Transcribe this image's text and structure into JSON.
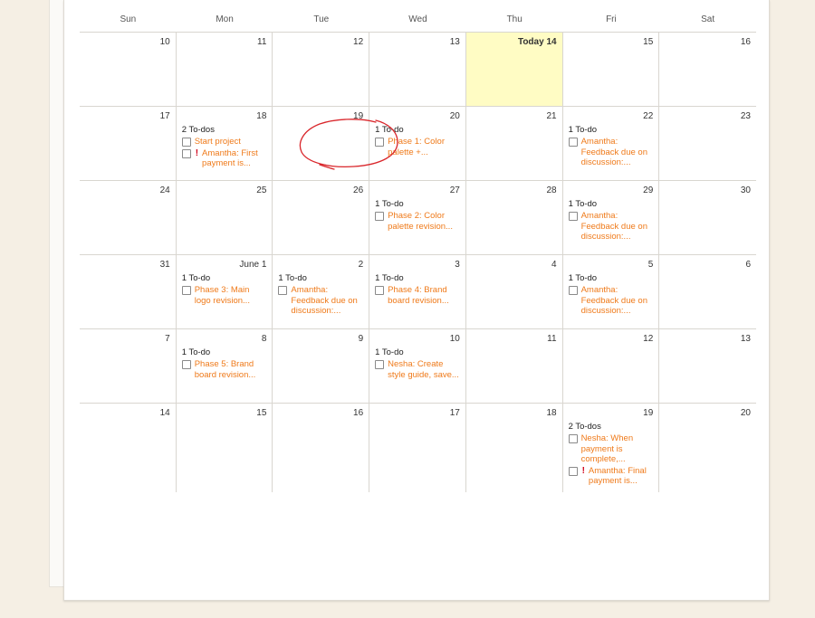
{
  "weekdays": [
    "Sun",
    "Mon",
    "Tue",
    "Wed",
    "Thu",
    "Fri",
    "Sat"
  ],
  "weeks": [
    [
      {
        "label": "10"
      },
      {
        "label": "11"
      },
      {
        "label": "12"
      },
      {
        "label": "13"
      },
      {
        "label": "Today 14",
        "today": true
      },
      {
        "label": "15"
      },
      {
        "label": "16"
      }
    ],
    [
      {
        "label": "17"
      },
      {
        "label": "18",
        "count": "2 To-dos",
        "todos": [
          {
            "text": "Start project"
          },
          {
            "text": "Amantha: First payment is...",
            "alert": true
          }
        ]
      },
      {
        "label": "19"
      },
      {
        "label": "20",
        "count": "1 To-do",
        "todos": [
          {
            "text": "Phase 1: Color palette +..."
          }
        ]
      },
      {
        "label": "21"
      },
      {
        "label": "22",
        "count": "1 To-do",
        "todos": [
          {
            "text": "Amantha: Feedback due on discussion:..."
          }
        ]
      },
      {
        "label": "23"
      }
    ],
    [
      {
        "label": "24"
      },
      {
        "label": "25"
      },
      {
        "label": "26"
      },
      {
        "label": "27",
        "count": "1 To-do",
        "todos": [
          {
            "text": "Phase 2: Color palette revision..."
          }
        ]
      },
      {
        "label": "28"
      },
      {
        "label": "29",
        "count": "1 To-do",
        "todos": [
          {
            "text": "Amantha: Feedback due on discussion:..."
          }
        ]
      },
      {
        "label": "30"
      }
    ],
    [
      {
        "label": "31"
      },
      {
        "label": "June 1",
        "count": "1 To-do",
        "todos": [
          {
            "text": "Phase 3: Main logo revision..."
          }
        ]
      },
      {
        "label": "2",
        "count": "1 To-do",
        "todos": [
          {
            "text": "Amantha: Feedback due on discussion:..."
          }
        ]
      },
      {
        "label": "3",
        "count": "1 To-do",
        "todos": [
          {
            "text": "Phase 4: Brand board revision..."
          }
        ]
      },
      {
        "label": "4"
      },
      {
        "label": "5",
        "count": "1 To-do",
        "todos": [
          {
            "text": "Amantha: Feedback due on discussion:..."
          }
        ]
      },
      {
        "label": "6"
      }
    ],
    [
      {
        "label": "7"
      },
      {
        "label": "8",
        "count": "1 To-do",
        "todos": [
          {
            "text": "Phase 5: Brand board revision..."
          }
        ]
      },
      {
        "label": "9"
      },
      {
        "label": "10",
        "count": "1 To-do",
        "todos": [
          {
            "text": "Nesha: Create style guide, save..."
          }
        ]
      },
      {
        "label": "11"
      },
      {
        "label": "12"
      },
      {
        "label": "13"
      }
    ],
    [
      {
        "label": "14"
      },
      {
        "label": "15"
      },
      {
        "label": "16"
      },
      {
        "label": "17"
      },
      {
        "label": "18"
      },
      {
        "label": "19",
        "count": "2 To-dos",
        "todos": [
          {
            "text": "Nesha: When payment is complete,..."
          },
          {
            "text": "Amantha: Final payment is...",
            "alert": true
          }
        ]
      },
      {
        "label": "20"
      }
    ]
  ],
  "colors": {
    "todo_link": "#ef7a1a",
    "today_bg": "#fffcc4",
    "alert": "#d0021b",
    "annotation": "#d9262b",
    "page_bg": "#f5efe4"
  },
  "icons": {
    "alert": "!"
  }
}
